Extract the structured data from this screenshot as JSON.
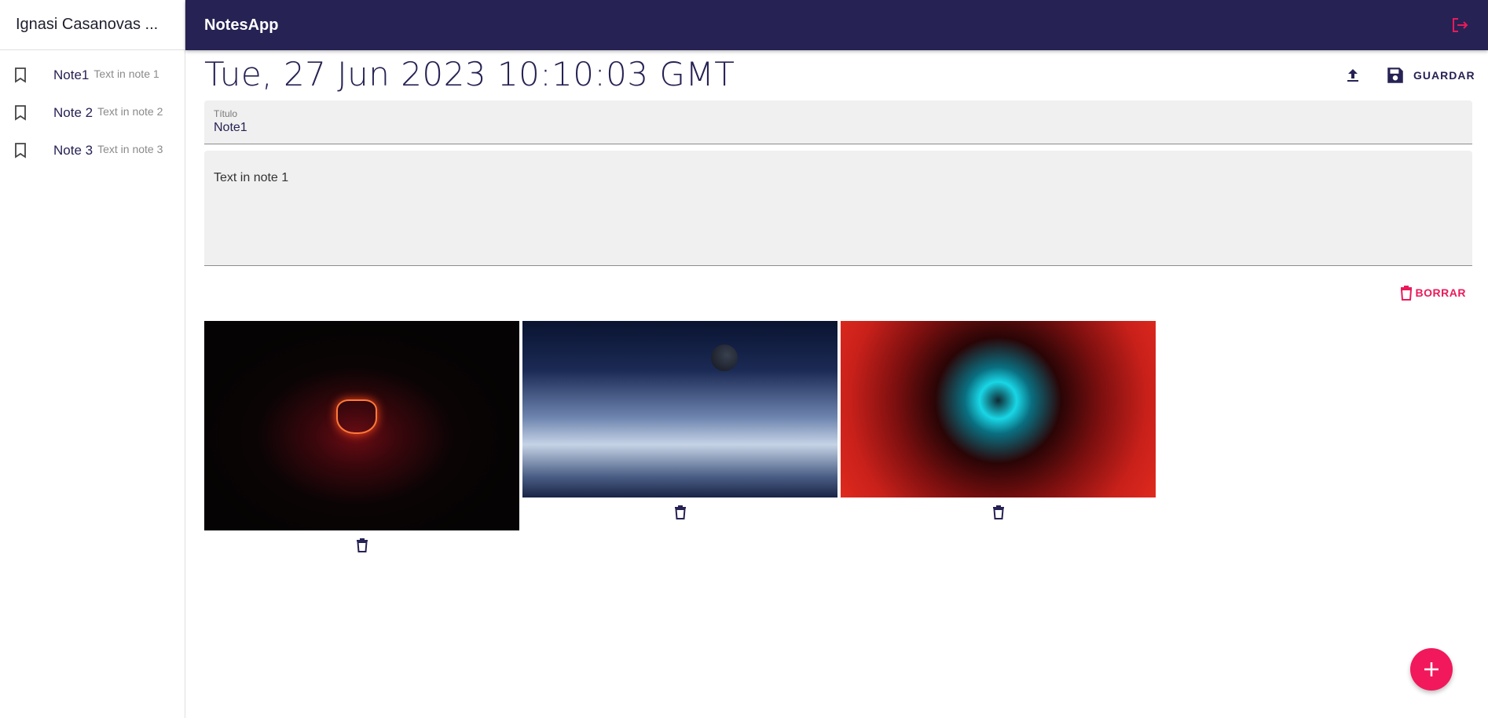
{
  "sidebar": {
    "user_name": "Ignasi Casanovas ...",
    "notes": [
      {
        "title": "Note1",
        "body": "Text in note 1",
        "icon": "bookmark-icon"
      },
      {
        "title": "Note 2",
        "body": "Text in note 2",
        "icon": "bookmark-icon"
      },
      {
        "title": "Note 3",
        "body": "Text in note 3",
        "icon": "bookmark-icon"
      }
    ]
  },
  "appbar": {
    "title": "NotesApp",
    "logout_icon": "logout-icon",
    "background": "#262254"
  },
  "editor": {
    "date": "Tue, 27 Jun 2023 10:10:03 GMT",
    "upload_icon": "upload-icon",
    "save_label": "GUARDAR",
    "title_label": "Título",
    "title_value": "Note1",
    "body_value": "Text in note 1",
    "delete_label": "BORRAR"
  },
  "gallery": {
    "images": [
      {
        "subject": "hooded-figure-neon-mask",
        "delete_icon": "trash-icon"
      },
      {
        "subject": "planet-over-clouds",
        "delete_icon": "trash-icon"
      },
      {
        "subject": "cyber-eye-binary",
        "delete_icon": "trash-icon"
      }
    ]
  },
  "fab": {
    "icon": "plus-icon",
    "color": "#f2185c"
  },
  "colors": {
    "primary": "#262254",
    "accent": "#ea1a5a"
  }
}
